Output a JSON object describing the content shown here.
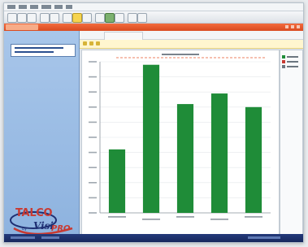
{
  "logo": {
    "name": "TALCO",
    "product": "Visi",
    "edition": "PRO",
    "byline": "by"
  },
  "colors": {
    "bar": "#1f8c38",
    "accent": "#e85a2c",
    "side": "#9dbde6",
    "highlight": "#fff6cf"
  },
  "chart_data": {
    "type": "bar",
    "categories": [
      "",
      "",
      "",
      "",
      ""
    ],
    "values": [
      0.42,
      0.98,
      0.72,
      0.79,
      0.7
    ],
    "ylim": [
      0,
      1
    ],
    "grid": true,
    "legend": "right"
  }
}
